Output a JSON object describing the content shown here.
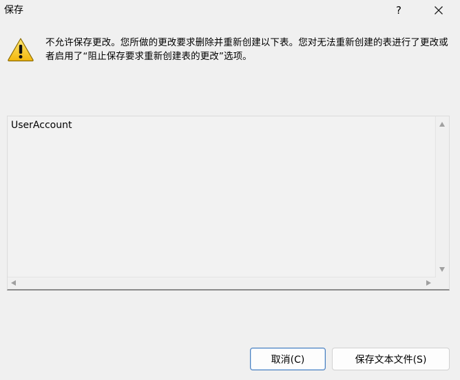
{
  "window": {
    "title": "保存",
    "help_label": "?",
    "close_icon": "close-icon"
  },
  "message": {
    "icon": "warning-icon",
    "text": "不允许保存更改。您所做的更改要求删除并重新创建以下表。您对无法重新创建的表进行了更改或者启用了“阻止保存要求重新创建表的更改”选项。"
  },
  "table_list": {
    "items": [
      "UserAccount"
    ]
  },
  "buttons": {
    "cancel_label": "取消(C)",
    "save_text_label": "保存文本文件(S)"
  },
  "colors": {
    "warning_yellow": "#f5c518",
    "default_button_border": "#4a7fbf",
    "dialog_background": "#f0f0f0"
  }
}
